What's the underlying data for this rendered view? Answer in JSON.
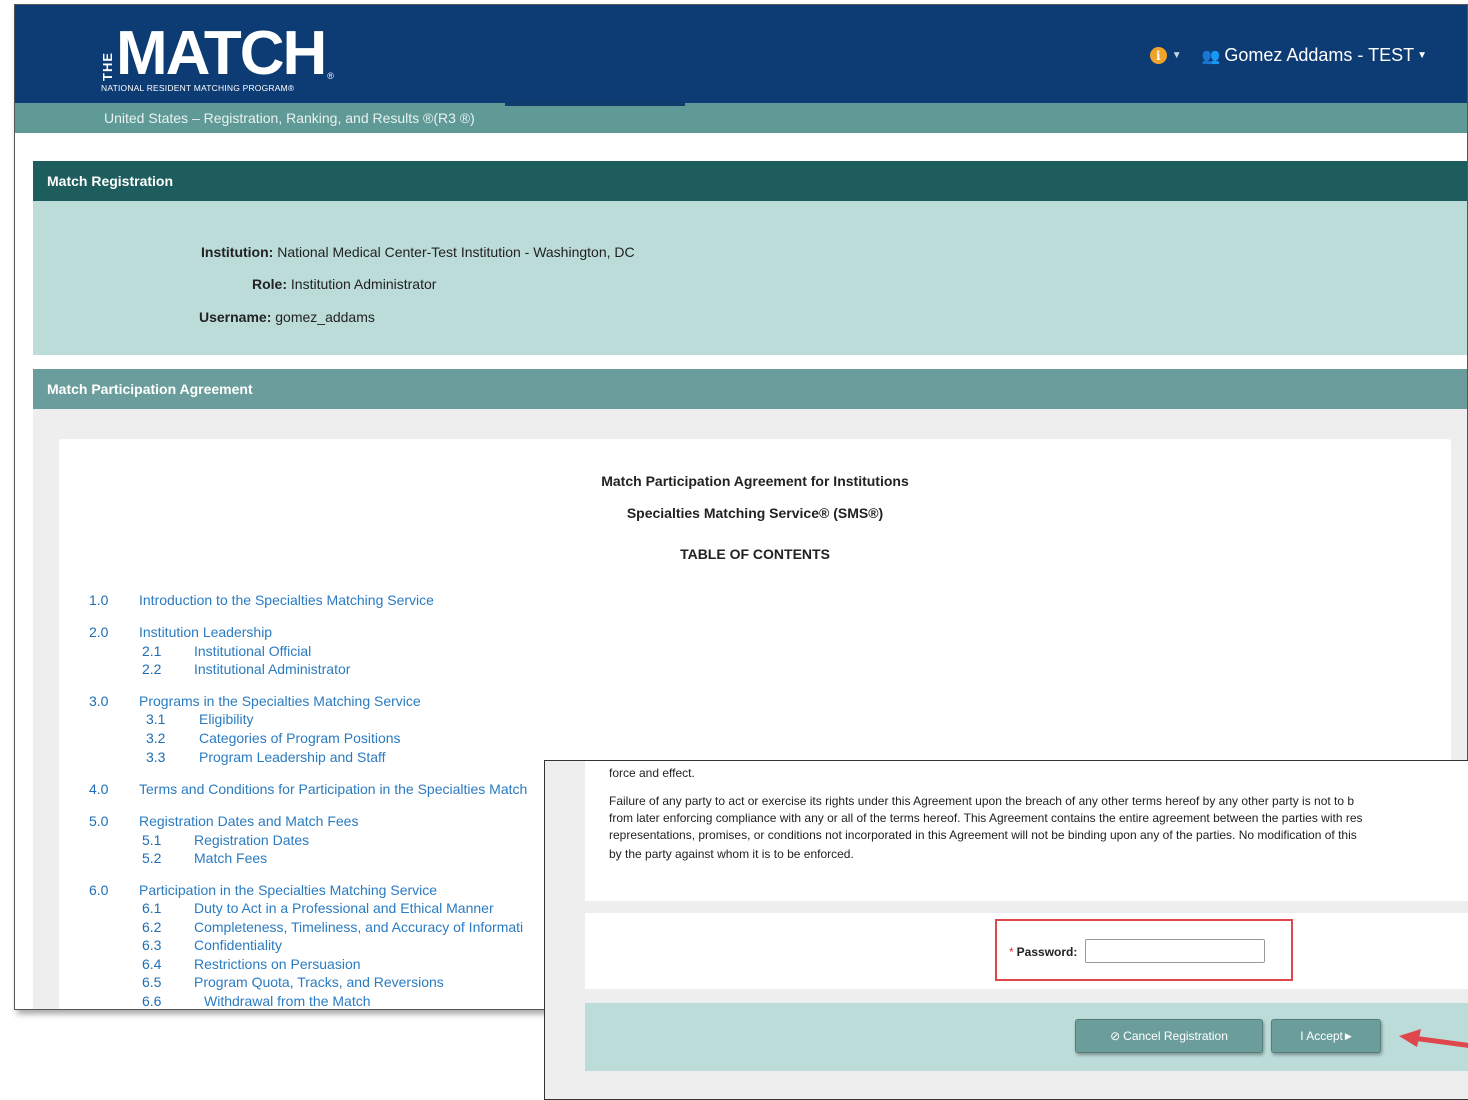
{
  "header": {
    "logo_the": "THE",
    "logo_match": "MATCH",
    "logo_reg": "®",
    "logo_sub": "NATIONAL RESIDENT MATCHING PROGRAM®",
    "info_glyph": "i",
    "info_icon": "info-circle-icon",
    "user_icon": "user-icon",
    "user_name": "Gomez Addams - TEST"
  },
  "subbar": {
    "text": "United States  – Registration, Ranking, and Results ®(R3 ®)"
  },
  "registration": {
    "title": "Match Registration",
    "institution_label": "Institution:",
    "institution_value": "National Medical Center-Test Institution - Washington, DC",
    "role_label": "Role:",
    "role_value": "Institution Administrator",
    "username_label": "Username:",
    "username_value": "gomez_addams"
  },
  "agreement": {
    "section_title": "Match Participation Agreement",
    "title1": "Match Participation Agreement for Institutions",
    "title2": "Specialties Matching Service® (SMS®)",
    "toc_title": "TABLE OF CONTENTS",
    "toc": [
      {
        "num": "1.0",
        "text": "Introduction to the Specialties Matching Service"
      },
      {
        "num": "2.0",
        "text": "Institution Leadership"
      },
      {
        "num": "2.1",
        "text": "Institutional Official"
      },
      {
        "num": "2.2",
        "text": "Institutional Administrator"
      },
      {
        "num": "3.0",
        "text": "Programs in the Specialties Matching Service"
      },
      {
        "num": "3.1",
        "text": "Eligibility"
      },
      {
        "num": "3.2",
        "text": "Categories of Program Positions"
      },
      {
        "num": "3.3",
        "text": "Program Leadership and Staff"
      },
      {
        "num": "4.0",
        "text": "Terms and Conditions for Participation in the Specialties Match"
      },
      {
        "num": "5.0",
        "text": "Registration Dates and Match Fees"
      },
      {
        "num": "5.1",
        "text": "Registration Dates"
      },
      {
        "num": "5.2",
        "text": "Match Fees"
      },
      {
        "num": "6.0",
        "text": "Participation in the Specialties Matching Service"
      },
      {
        "num": "6.1",
        "text": "Duty to Act in a Professional and Ethical Manner"
      },
      {
        "num": "6.2",
        "text": "Completeness, Timeliness, and Accuracy of Informati"
      },
      {
        "num": "6.3",
        "text": "Confidentiality"
      },
      {
        "num": "6.4",
        "text": "Restrictions on Persuasion"
      },
      {
        "num": "6.5",
        "text": "Program Quota, Tracks, and Reversions"
      },
      {
        "num": "6.6",
        "text": "Withdrawal from the Match"
      }
    ]
  },
  "overlay": {
    "line0": "force and effect.",
    "line1": "Failure of any party to act or exercise its rights under this Agreement upon the breach of any other terms hereof by any other party is not to b",
    "line2": "from later enforcing compliance with any or all of the terms hereof. This Agreement contains the entire agreement between the parties with res",
    "line3": "representations, promises, or conditions not incorporated in this Agreement will not be binding upon any of the parties.  No modification of this",
    "line4": "by the party against whom it is to be enforced.",
    "password_required": "*",
    "password_label": "Password:",
    "password_value": "",
    "cancel_icon": "ban-icon",
    "cancel_label": "Cancel Registration",
    "accept_label": "I Accept",
    "accept_icon": "caret-right-icon",
    "accent_color": "#e0474c"
  }
}
